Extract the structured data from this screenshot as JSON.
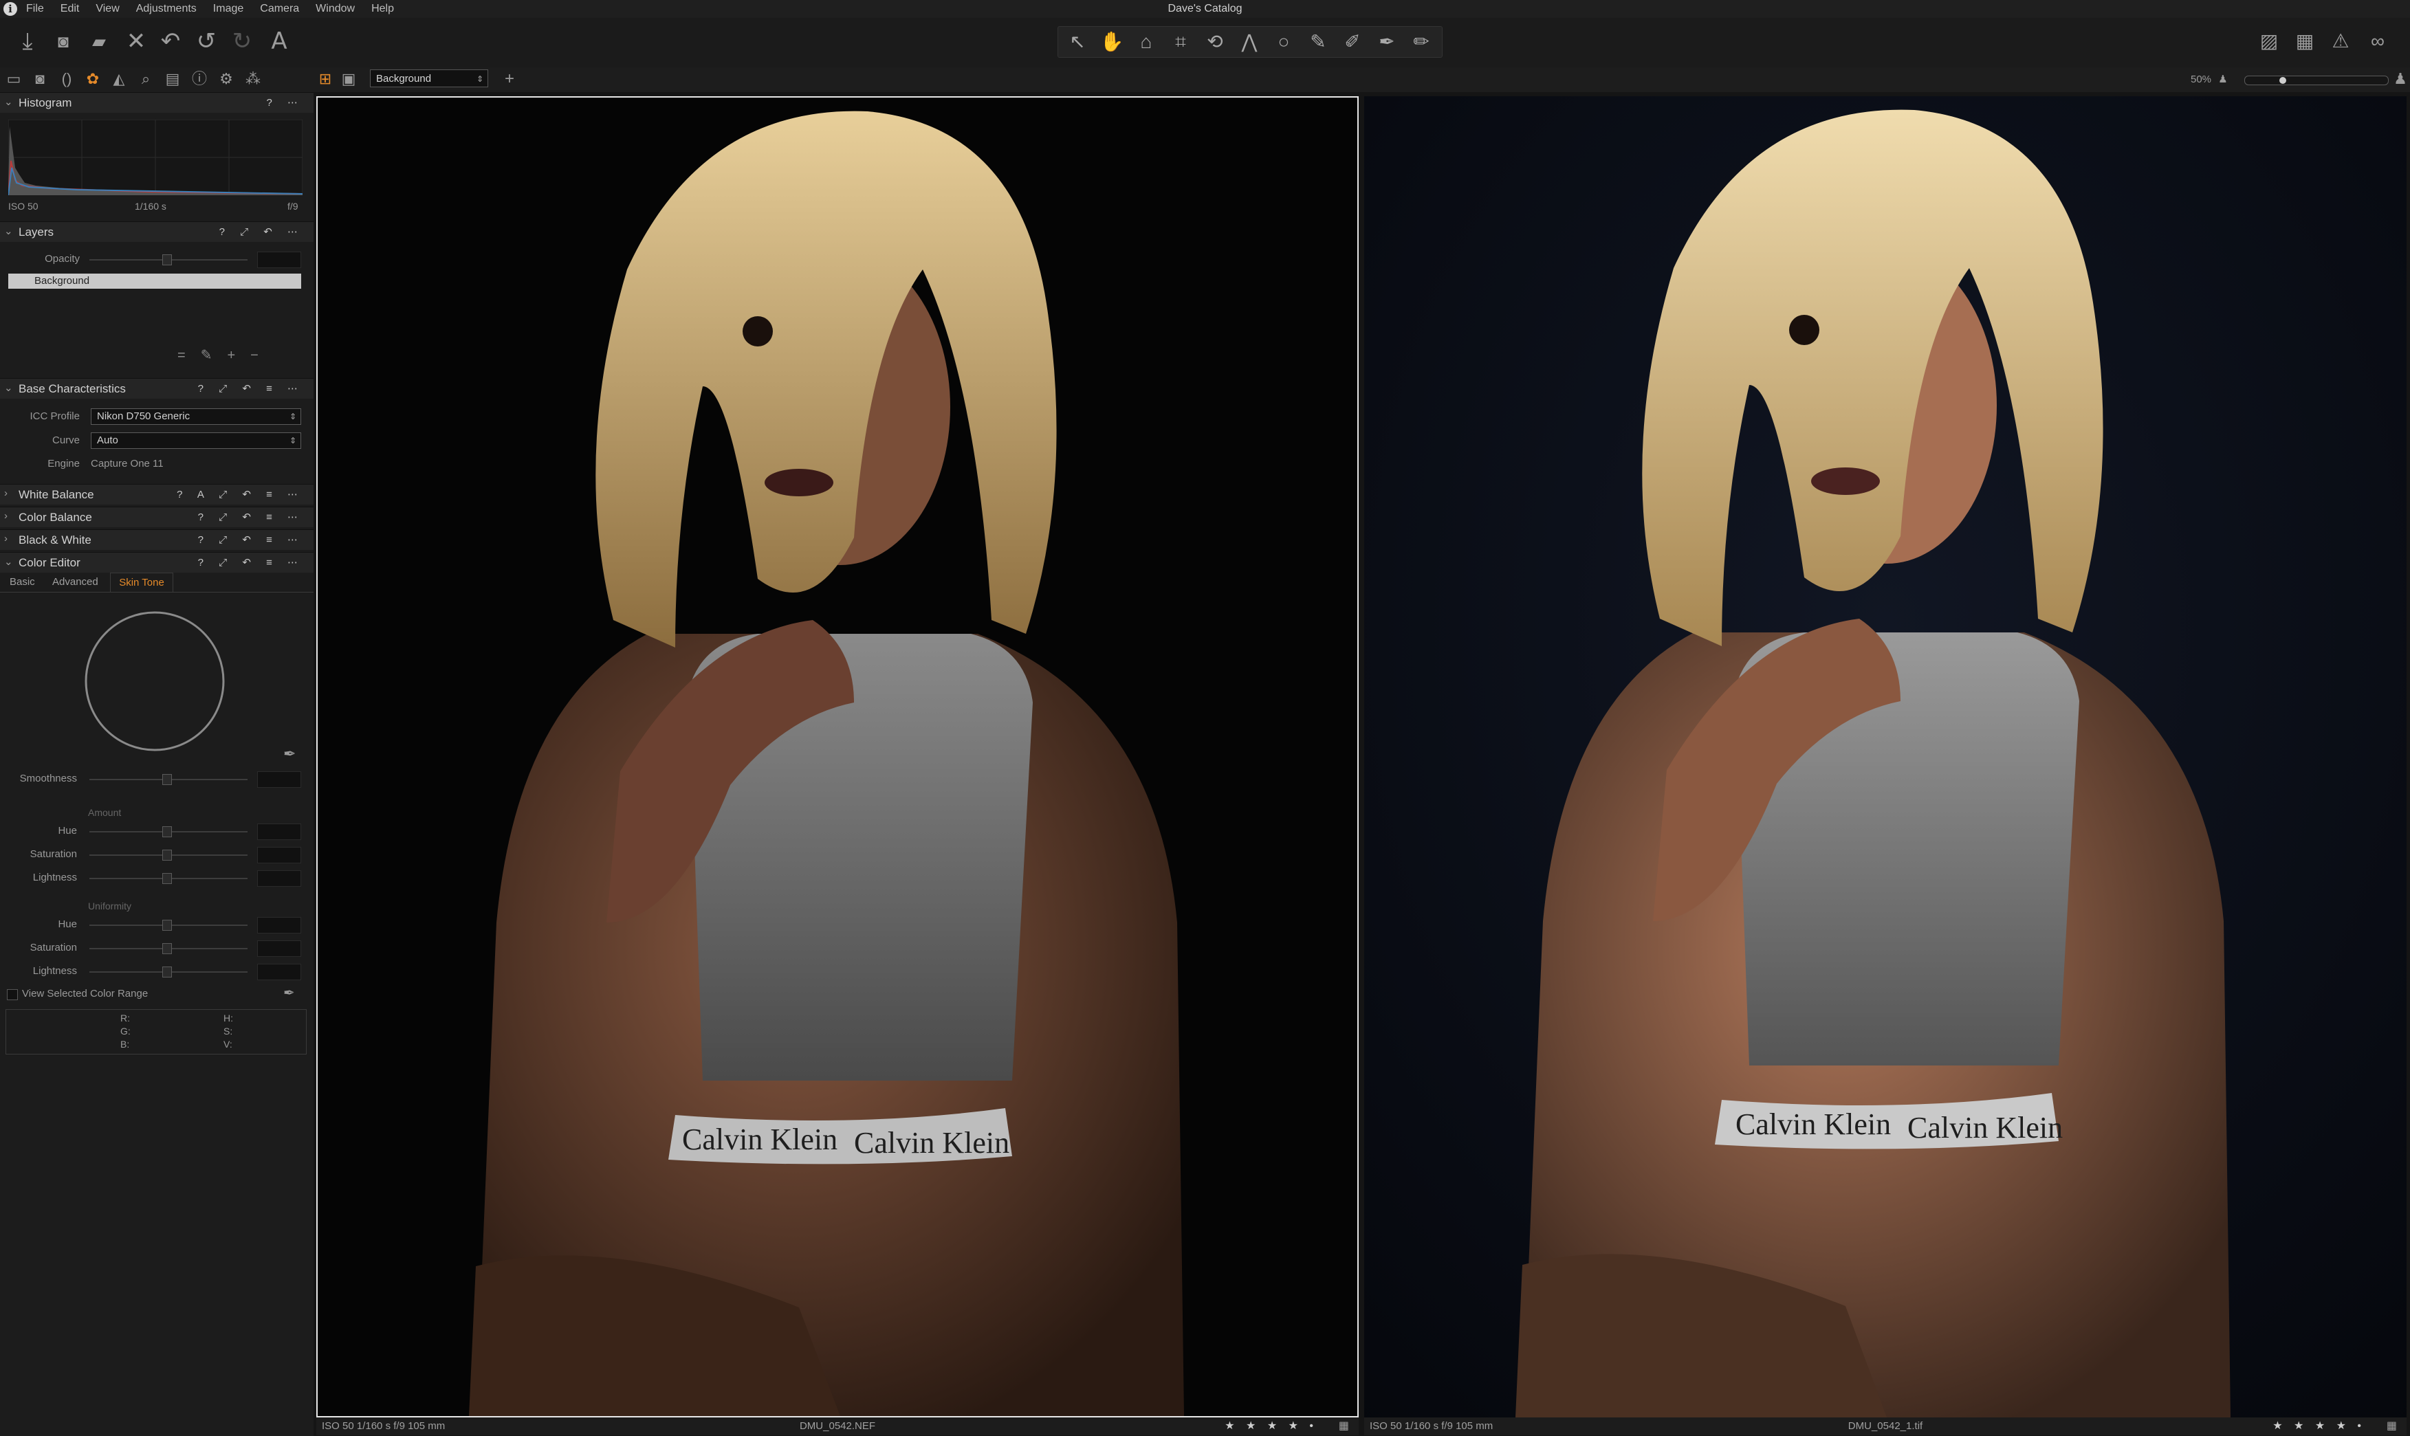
{
  "app": {
    "catalog_title": "Dave's Catalog",
    "menus": [
      "File",
      "Edit",
      "View",
      "Adjustments",
      "Image",
      "Camera",
      "Window",
      "Help"
    ]
  },
  "toolbar": {
    "left_icons": [
      "import-icon",
      "camera-icon",
      "process-icon",
      "delete-icon",
      "undo-icon",
      "undo-alt-icon",
      "redo-icon",
      "text-icon"
    ],
    "cursor_tools": [
      "select-icon",
      "pan-icon",
      "loupe-icon",
      "crop-icon",
      "rotate-icon",
      "keystone-icon",
      "spot-icon",
      "brush-icon",
      "gradient-icon",
      "eyedropper-icon",
      "eraser-icon"
    ],
    "right_icons": [
      "proof-icon",
      "grid-icon",
      "exposure-warning-icon",
      "glasses-icon"
    ]
  },
  "viewer_bar": {
    "layer_select": "Background",
    "zoom": "50%"
  },
  "histogram": {
    "title": "Histogram",
    "iso": "ISO 50",
    "shutter": "1/160 s",
    "aperture": "f/9"
  },
  "layers": {
    "title": "Layers",
    "opacity_label": "Opacity",
    "items": [
      "Background"
    ]
  },
  "base_characteristics": {
    "title": "Base Characteristics",
    "icc_label": "ICC Profile",
    "icc_value": "Nikon D750 Generic",
    "curve_label": "Curve",
    "curve_value": "Auto",
    "engine_label": "Engine",
    "engine_value": "Capture One 11"
  },
  "collapsed_sections": [
    "White Balance",
    "Color Balance",
    "Black & White"
  ],
  "color_editor": {
    "title": "Color Editor",
    "tabs": [
      "Basic",
      "Advanced",
      "Skin Tone"
    ],
    "active_tab": "Skin Tone",
    "smoothness_label": "Smoothness",
    "amount_group": "Amount",
    "uniformity_group": "Uniformity",
    "hue_label": "Hue",
    "saturation_label": "Saturation",
    "lightness_label": "Lightness",
    "view_range_label": "View Selected Color Range",
    "readout": {
      "r": "R:",
      "g": "G:",
      "b": "B:",
      "h": "H:",
      "s": "S:",
      "v": "V:"
    }
  },
  "viewer": {
    "left_photo": {
      "exif": "ISO 50 1/160 s f/9 105 mm",
      "filename": "DMU_0542.NEF",
      "rating": "★ ★ ★ ★ •"
    },
    "right_photo": {
      "exif": "ISO 50 1/160 s f/9 105 mm",
      "filename": "DMU_0542_1.tif",
      "rating": "★ ★ ★ ★ •"
    },
    "brand_text": "Calvin Klein"
  }
}
